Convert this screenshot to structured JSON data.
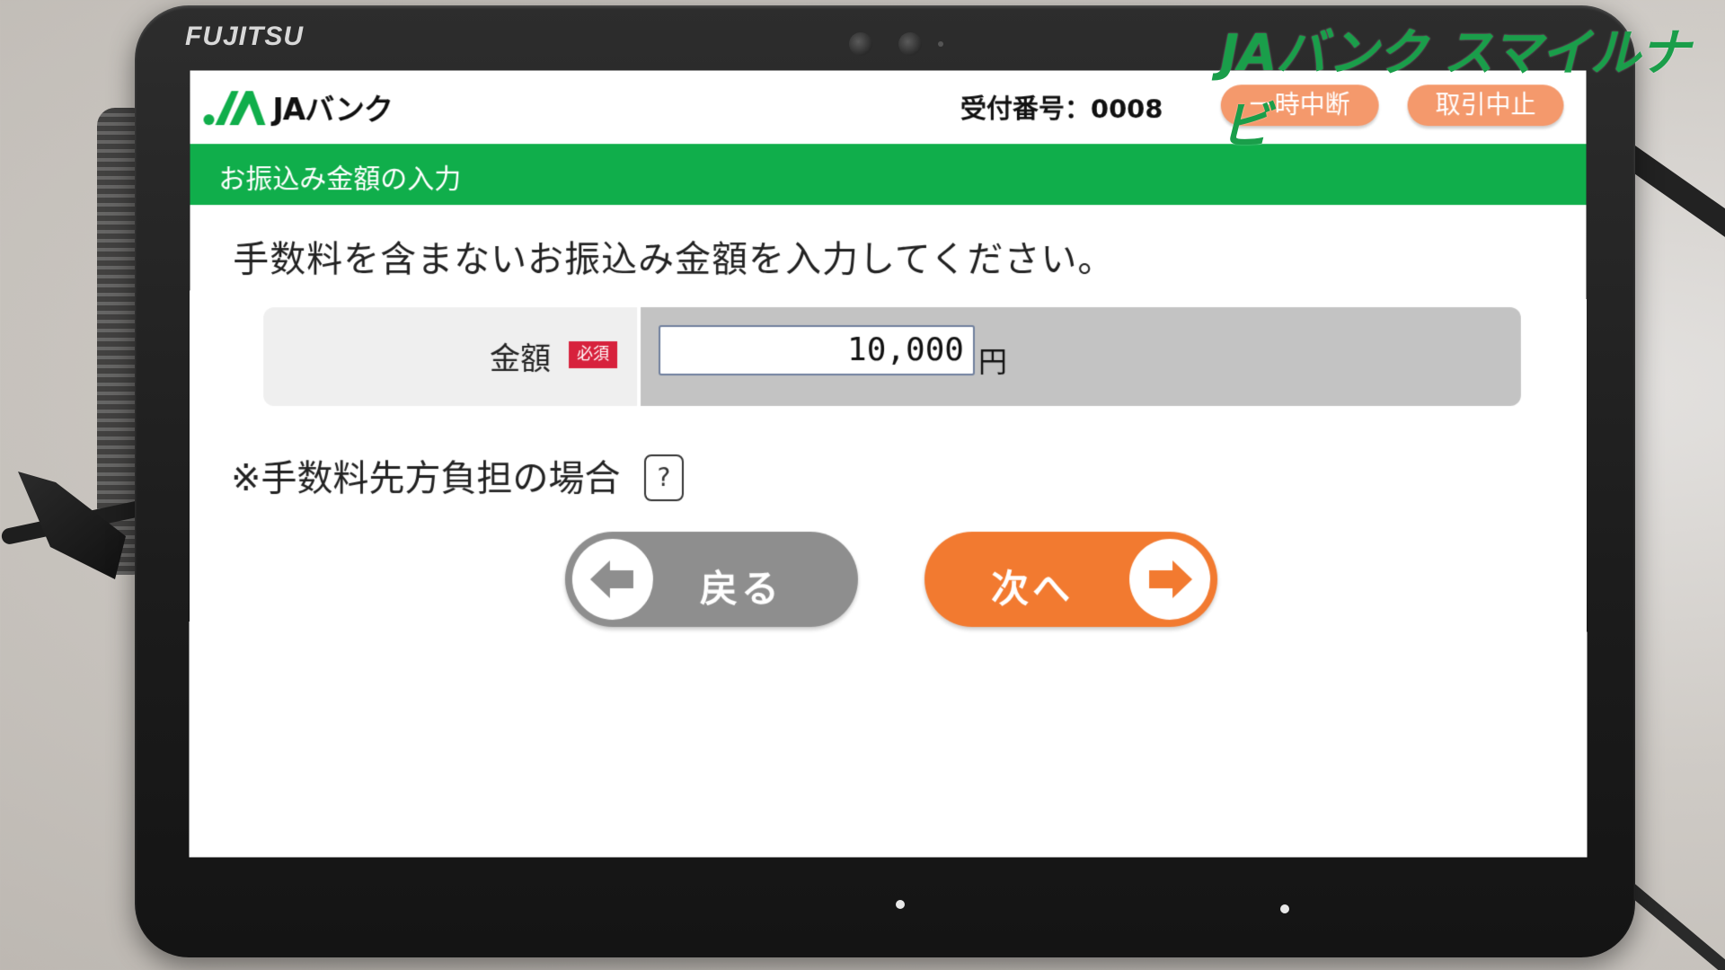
{
  "overlay": {
    "app_title": "JAバンク スマイルナビ"
  },
  "device": {
    "brand": "FUJITSU"
  },
  "header": {
    "logo_text": "JAバンク",
    "ticket_label": "受付番号：0008",
    "pause_label": "一時中断",
    "cancel_label": "取引中止"
  },
  "section": {
    "title": "お振込み金額の入力"
  },
  "main": {
    "instruction": "手数料を含まないお振込み金額を入力してください。",
    "amount_label": "金額",
    "required_badge": "必須",
    "amount_value": "10,000",
    "amount_unit": "円",
    "fee_note": "※手数料先方負担の場合",
    "help_label": "?"
  },
  "nav": {
    "back_label": "戻る",
    "next_label": "次へ"
  },
  "colors": {
    "brand_green": "#10ae4b",
    "accent_orange": "#f27a30",
    "header_button": "#f4996c",
    "back_gray": "#8e8e8e",
    "required_red": "#d7213c"
  },
  "icons": [
    "ja-logo-icon",
    "arrow-left-icon",
    "arrow-right-icon",
    "question-icon"
  ]
}
